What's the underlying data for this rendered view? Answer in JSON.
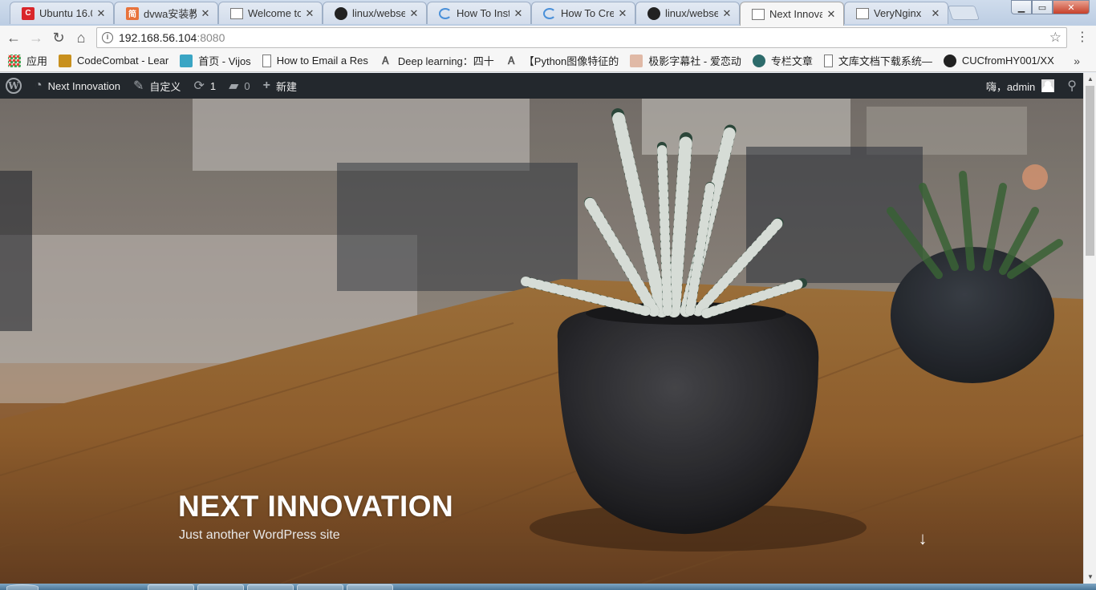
{
  "browser": {
    "tabs": [
      {
        "title": "Ubuntu 16.0",
        "favicon": "c-red-icon",
        "color": "#d9262b",
        "glyph": "C"
      },
      {
        "title": "dvwa安装教",
        "favicon": "jian-orange-icon",
        "color": "#e8733c",
        "glyph": "简"
      },
      {
        "title": "Welcome to",
        "favicon": "page-icon",
        "color": "",
        "glyph": ""
      },
      {
        "title": "linux/webse",
        "favicon": "github-icon",
        "color": "#222",
        "glyph": ""
      },
      {
        "title": "How To Inst",
        "favicon": "loading-spinner-icon",
        "color": "#4a90d9",
        "glyph": ""
      },
      {
        "title": "How To Cre",
        "favicon": "loading-spinner-icon",
        "color": "#4a90d9",
        "glyph": ""
      },
      {
        "title": "linux/webse",
        "favicon": "github-icon",
        "color": "#222",
        "glyph": ""
      },
      {
        "title": "Next Innova",
        "favicon": "page-icon",
        "color": "",
        "glyph": "",
        "active": true
      },
      {
        "title": "VeryNginx",
        "favicon": "page-icon",
        "color": "",
        "glyph": ""
      }
    ],
    "url_host": "192.168.56.104",
    "url_port": ":8080",
    "bookmarks": [
      {
        "label": "应用",
        "icon": "apps-grid-icon"
      },
      {
        "label": "CodeCombat - Lear",
        "icon": "codecombat-icon"
      },
      {
        "label": "首页 - Vijos",
        "icon": "vijos-icon"
      },
      {
        "label": "How to Email a Res",
        "icon": "page-icon"
      },
      {
        "label": "Deep learning：四十",
        "icon": "zhihu-icon"
      },
      {
        "label": "【Python图像特征的",
        "icon": "zhihu-icon"
      },
      {
        "label": "极影字幕社 - 爱恋动",
        "icon": "anime-avatar-icon"
      },
      {
        "label": "专栏文章",
        "icon": "teal-circle-icon"
      },
      {
        "label": "文库文档下载系统—",
        "icon": "page-icon"
      },
      {
        "label": "CUCfromHY001/XX",
        "icon": "github-icon"
      }
    ],
    "bookmarks_more": "»"
  },
  "wp_admin_bar": {
    "site_name": "Next Innovation",
    "customize": "自定义",
    "updates_count": "1",
    "comments_count": "0",
    "new_label": "新建",
    "greeting": "嗨，admin"
  },
  "hero": {
    "title": "NEXT INNOVATION",
    "tagline": "Just another WordPress site",
    "scroll_icon": "arrow-down-icon"
  }
}
